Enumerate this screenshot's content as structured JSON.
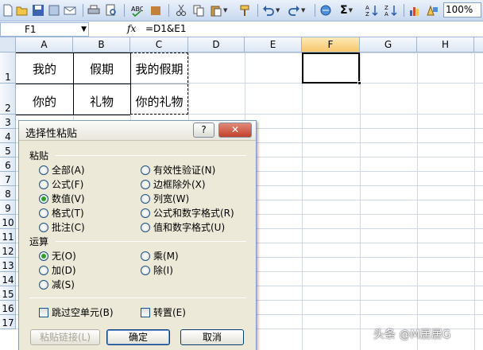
{
  "toolbar": {
    "zoom": "100%",
    "icons": [
      "new-icon",
      "open-icon",
      "save-icon",
      "permission-icon",
      "email-icon",
      "print-icon",
      "print-preview-icon",
      "spelling-icon",
      "research-icon",
      "cut-icon",
      "copy-icon",
      "paste-icon",
      "format-painter-icon",
      "undo-icon",
      "redo-icon",
      "hyperlink-icon",
      "autosum-icon",
      "sort-ascending-icon",
      "sort-descending-icon",
      "chart-wizard-icon",
      "drawing-icon"
    ],
    "autosum": "Σ"
  },
  "formula_bar": {
    "name_box": "F1",
    "fx": "fx",
    "formula": "=D1&E1"
  },
  "grid": {
    "columns": [
      "A",
      "B",
      "C",
      "D",
      "E",
      "F",
      "G",
      "H"
    ],
    "selected_column": "F",
    "rows": [
      "1",
      "2",
      "3",
      "4",
      "5",
      "6",
      "7",
      "8",
      "9",
      "10",
      "11",
      "12",
      "13",
      "14",
      "15",
      "16",
      "17"
    ],
    "cells": {
      "A1": "我的",
      "B1": "假期",
      "C1": "我的假期",
      "A2": "你的",
      "B2": "礼物",
      "C2": "你的礼物"
    }
  },
  "dialog": {
    "title": "选择性粘贴",
    "help": "?",
    "close": "✕",
    "paste_group": "粘贴",
    "paste_left": [
      "全部(A)",
      "公式(F)",
      "数值(V)",
      "格式(T)",
      "批注(C)"
    ],
    "paste_right": [
      "有效性验证(N)",
      "边框除外(X)",
      "列宽(W)",
      "公式和数字格式(R)",
      "值和数字格式(U)"
    ],
    "selected_paste": "数值(V)",
    "operation_group": "运算",
    "op_left": [
      "无(O)",
      "加(D)",
      "减(S)"
    ],
    "op_right": [
      "乘(M)",
      "除(I)"
    ],
    "selected_op": "无(O)",
    "skip_blanks": "跳过空单元(B)",
    "transpose": "转置(E)",
    "paste_link": "粘贴链接(L)",
    "ok": "确定",
    "cancel": "取消"
  },
  "watermark": "头条 @M居居G",
  "colors": {
    "header_bg": "#dde7f4",
    "selected_header": "#f8c76a",
    "dialog_bg": "#ece9d8",
    "close_button": "#c1412b"
  }
}
